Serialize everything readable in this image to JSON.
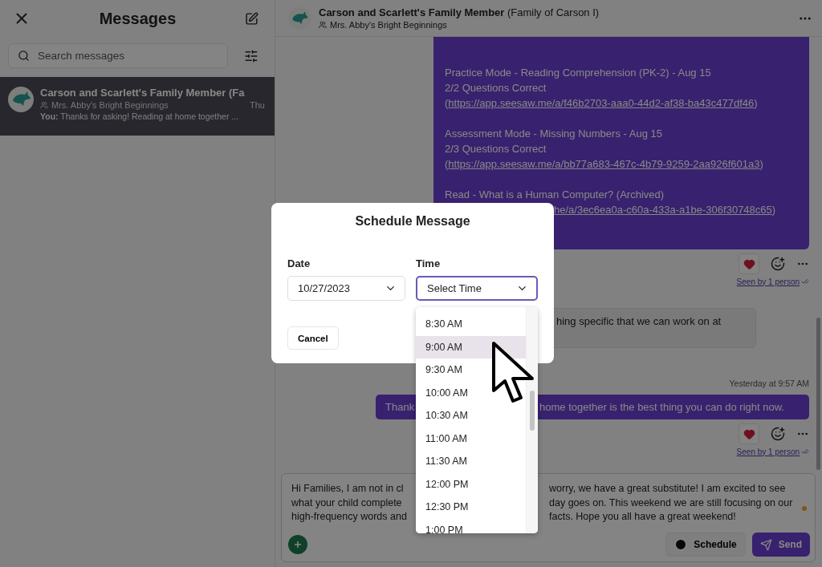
{
  "sidebar": {
    "title": "Messages",
    "search": {
      "placeholder": "Search messages"
    },
    "conversations": [
      {
        "name": "Carson and Scarlett's Family Member (Fa",
        "class": "Mrs. Abby's Bright Beginnings",
        "time": "Thu",
        "preview": "**You:** Thanks for asking! Reading at home together ...",
        "selected": true
      }
    ]
  },
  "chat": {
    "title": "**Carson and Scarlett's Family Member** (Family of Carson I)",
    "subtitle": "Mrs. Abby's Bright Beginnings",
    "messages": [
      {
        "kind": "sent",
        "paragraphs": [
          [
            {
              "kind": "text",
              "text": "Practice Mode - Reading Comprehension (PK-2) - Aug 15"
            },
            {
              "kind": "text",
              "text": "2/2 Questions Correct"
            },
            {
              "kind": "link",
              "open": "(",
              "url": "https://app.seesaw.me/a/f46b2703-aaa0-44d2-af38-ba43c477df46",
              "close": ")"
            }
          ],
          [
            {
              "kind": "text",
              "text": "Assessment Mode - Missing Numbers - Aug 15"
            },
            {
              "kind": "text",
              "text": "2/3 Questions Correct"
            },
            {
              "kind": "link",
              "open": "(",
              "url": "https://app.seesaw.me/a/bb77a683-467c-4b79-9259-2aa926f601a3",
              "close": ")"
            }
          ],
          [
            {
              "kind": "text",
              "text": "Read - What is a Human Computer? (Archived)"
            },
            {
              "kind": "covered-link",
              "url": "he/a/3ec6ea0a-c60a-433a-a1be-306f30748c65",
              "close": ")"
            }
          ]
        ],
        "liked": true,
        "seen": "Seen by 1 person"
      },
      {
        "kind": "received",
        "text": "hing specific that we can work on at"
      },
      {
        "kind": "sent-short",
        "time": "Yesterday at 9:57 AM",
        "left": "Thank",
        "right": "home together is the best thing you can do right now.",
        "liked": true,
        "seen": "Seen by 1 person"
      }
    ],
    "composer": {
      "lines": [
        {
          "left": "Hi Families, I am not in cl",
          "right": "worry, we have a great substitute! I am excited to see"
        },
        {
          "left": "what your child complete",
          "right": "day goes on. This weekend we are still focusing on our"
        },
        {
          "left": "high-frequency words and",
          "right": "facts. Hope you all have a great weekend!"
        }
      ],
      "unsaved": true,
      "schedule": "Schedule",
      "send": "Send"
    }
  },
  "dialog": {
    "title": "Schedule Message",
    "date": {
      "label": "Date",
      "value": "10/27/2023"
    },
    "time": {
      "label": "Time",
      "placeholder": "Select Time",
      "open": true,
      "options": [
        {
          "label": "8:30 AM",
          "selected": false
        },
        {
          "label": "9:00 AM",
          "selected": true
        },
        {
          "label": "9:30 AM",
          "selected": false
        },
        {
          "label": "10:00 AM",
          "selected": false
        },
        {
          "label": "10:30 AM",
          "selected": false
        },
        {
          "label": "11:00 AM",
          "selected": false
        },
        {
          "label": "11:30 AM",
          "selected": false
        },
        {
          "label": "12:00 PM",
          "selected": false
        },
        {
          "label": "12:30 PM",
          "selected": false
        },
        {
          "label": "1:00 PM",
          "selected": false
        }
      ]
    },
    "cancel": "Cancel"
  }
}
